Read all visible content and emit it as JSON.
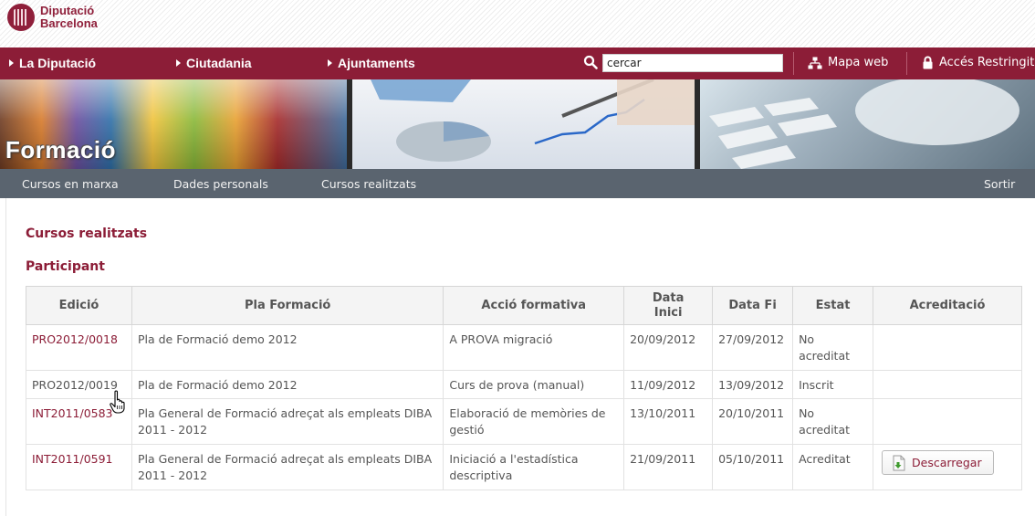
{
  "brand": {
    "name_line1": "Diputació",
    "name_line2": "Barcelona",
    "logo_icon": "seal-icon",
    "accent_color": "#8c1d37"
  },
  "mainnav": {
    "items": [
      {
        "label": "La Diputació"
      },
      {
        "label": "Ciutadania"
      },
      {
        "label": "Ajuntaments"
      }
    ],
    "search": {
      "value": "cercar",
      "icon": "search-icon"
    },
    "sitemap": {
      "label": "Mapa web",
      "icon": "sitemap-icon"
    },
    "restricted": {
      "label": "Accés Restringit",
      "icon": "lock-icon"
    }
  },
  "banner": {
    "title": "Formació"
  },
  "subnav": {
    "items": [
      {
        "label": "Cursos en marxa"
      },
      {
        "label": "Dades personals"
      },
      {
        "label": "Cursos realitzats"
      }
    ],
    "logout": "Sortir"
  },
  "page": {
    "title": "Cursos realitzats",
    "subtitle": "Participant"
  },
  "table": {
    "headers": {
      "edicio": "Edició",
      "pla": "Pla Formació",
      "accio": "Acció formativa",
      "data_inici": "Data Inici",
      "data_fi": "Data Fi",
      "estat": "Estat",
      "acreditacio": "Acreditació"
    },
    "rows": [
      {
        "edicio": "PRO2012/0018",
        "pla": "Pla de Formació demo 2012",
        "accio": "A PROVA migració",
        "data_inici": "20/09/2012",
        "data_fi": "27/09/2012",
        "estat": "No acreditat",
        "acreditacio": ""
      },
      {
        "edicio": "PRO2012/0019",
        "pla": "Pla de Formació demo 2012",
        "accio": "Curs de prova (manual)",
        "data_inici": "11/09/2012",
        "data_fi": "13/09/2012",
        "estat": "Inscrit",
        "acreditacio": ""
      },
      {
        "edicio": "INT2011/0583",
        "pla": "Pla General de Formació adreçat als empleats DIBA 2011 - 2012",
        "accio": "Elaboració de memòries de gestió",
        "data_inici": "13/10/2011",
        "data_fi": "20/10/2011",
        "estat": "No acreditat",
        "acreditacio": ""
      },
      {
        "edicio": "INT2011/0591",
        "pla": "Pla General de Formació adreçat als empleats DIBA 2011 - 2012",
        "accio": "Iniciació a l'estadística descriptiva",
        "data_inici": "21/09/2011",
        "data_fi": "05/10/2011",
        "estat": "Acreditat",
        "acreditacio": "Descarregar"
      }
    ],
    "download_icon": "download-document-icon"
  }
}
